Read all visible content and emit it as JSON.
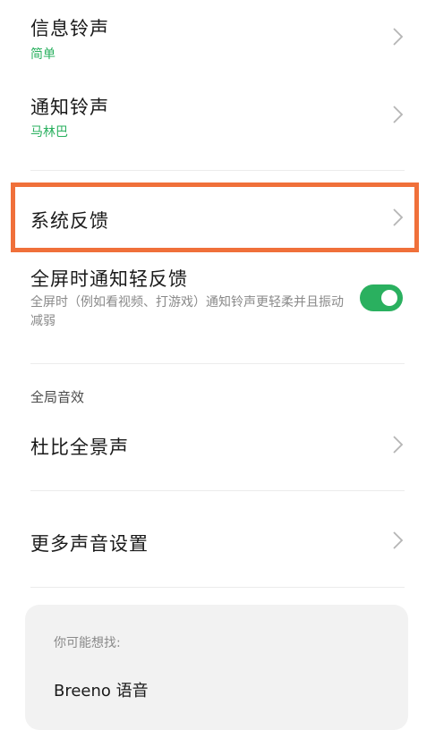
{
  "settings": {
    "message_ringtone": {
      "label": "信息铃声",
      "value": "简单"
    },
    "notification_ringtone": {
      "label": "通知铃声",
      "value": "马林巴"
    },
    "system_feedback": {
      "label": "系统反馈"
    },
    "fullscreen_notify": {
      "label": "全屏时通知轻反馈",
      "description": "全屏时（例如看视频、打游戏）通知铃声更轻柔并且振动减弱",
      "enabled": true
    }
  },
  "global_sound_effects": {
    "header": "全局音效",
    "dolby": {
      "label": "杜比全景声"
    }
  },
  "more_sound": {
    "label": "更多声音设置"
  },
  "suggestions": {
    "title": "你可能想找:",
    "items": [
      "Breeno 语音"
    ]
  },
  "colors": {
    "accent_green": "#2ab05f",
    "highlight_orange": "#f0703a"
  },
  "icons": {
    "row_chevron": "chevron-right-icon"
  }
}
